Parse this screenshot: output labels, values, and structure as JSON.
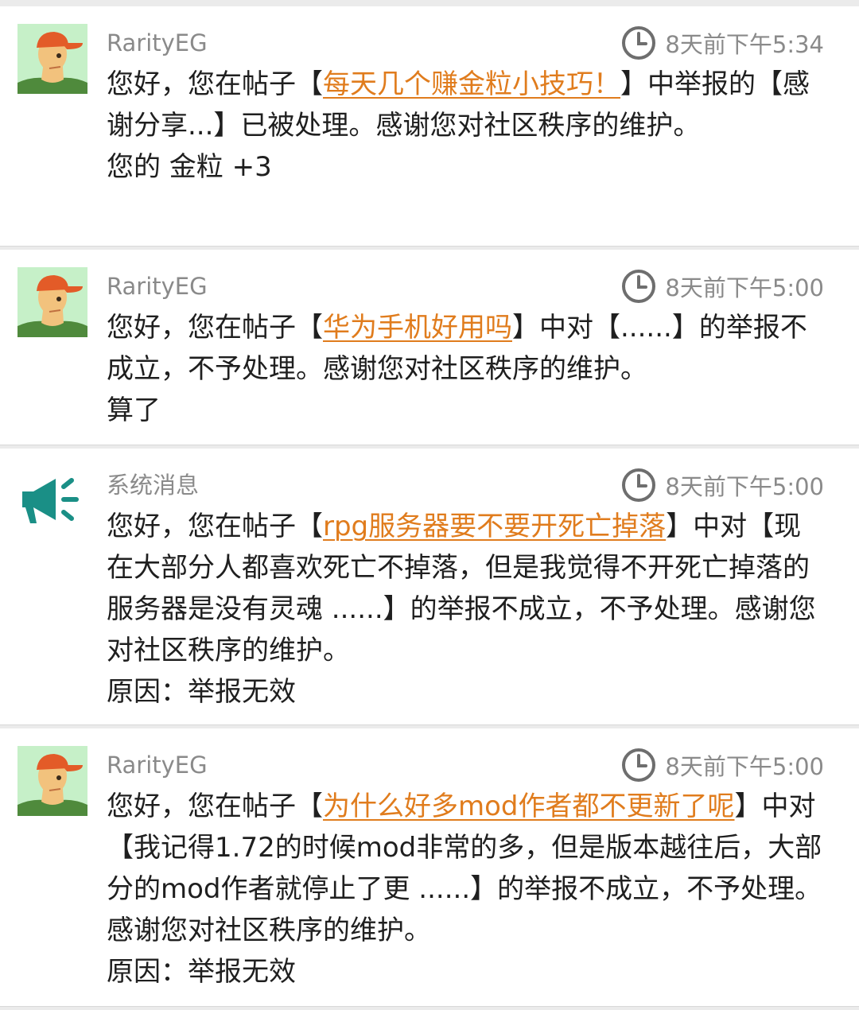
{
  "colors": {
    "link": "#e07c1d",
    "meta": "#8a8a8a",
    "system_icon": "#1a8f86",
    "background": "#ebebeb"
  },
  "messages": [
    {
      "sender": "RarityEG",
      "avatar_icon": "user-avatar-icon",
      "time": "8天前下午5:34",
      "body": [
        [
          {
            "text": "您好，您在帖子【"
          },
          {
            "text": "每天几个赚金粒小技巧！",
            "link": true
          },
          {
            "text": "】中举报的【感谢分享...】已被处理。感谢您对社区秩序的维护。"
          }
        ],
        [
          {
            "text": "您的 金粒 +3"
          }
        ]
      ]
    },
    {
      "sender": "RarityEG",
      "avatar_icon": "user-avatar-icon",
      "time": "8天前下午5:00",
      "body": [
        [
          {
            "text": "您好，您在帖子【"
          },
          {
            "text": "华为手机好用吗",
            "link": true
          },
          {
            "text": "】中对【......】的举报不成立，不予处理。感谢您对社区秩序的维护。"
          }
        ],
        [
          {
            "text": "算了"
          }
        ]
      ]
    },
    {
      "sender": "系统消息",
      "avatar_icon": "megaphone-icon",
      "time": "8天前下午5:00",
      "body": [
        [
          {
            "text": "您好，您在帖子【"
          },
          {
            "text": "rpg服务器要不要开死亡掉落",
            "link": true
          },
          {
            "text": "】中对【现在大部分人都喜欢死亡不掉落，但是我觉得不开死亡掉落的服务器是没有灵魂 ......】的举报不成立，不予处理。感谢您对社区秩序的维护。"
          }
        ],
        [
          {
            "text": "原因：举报无效"
          }
        ]
      ]
    },
    {
      "sender": "RarityEG",
      "avatar_icon": "user-avatar-icon",
      "time": "8天前下午5:00",
      "body": [
        [
          {
            "text": "您好，您在帖子【"
          },
          {
            "text": "为什么好多mod作者都不更新了呢",
            "link": true
          },
          {
            "text": "】中对【我记得1.72的时候mod非常的多，但是版本越往后，大部分的mod作者就停止了更 ......】的举报不成立，不予处理。感谢您对社区秩序的维护。"
          }
        ],
        [
          {
            "text": "原因：举报无效"
          }
        ]
      ]
    }
  ]
}
